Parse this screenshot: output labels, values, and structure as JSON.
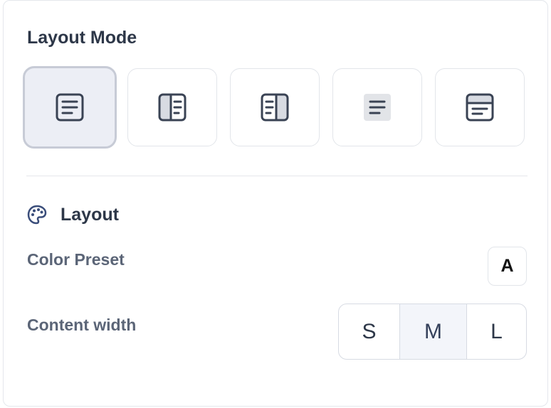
{
  "panel": {
    "title": "Layout Mode",
    "layout_modes": [
      {
        "name": "default",
        "icon": "document-lines-icon",
        "selected": true
      },
      {
        "name": "left-sidebar",
        "icon": "sidebar-left-icon",
        "selected": false
      },
      {
        "name": "right-sidebar",
        "icon": "sidebar-right-icon",
        "selected": false
      },
      {
        "name": "boxed",
        "icon": "boxed-lines-icon",
        "selected": false
      },
      {
        "name": "header-bar",
        "icon": "header-bar-icon",
        "selected": false
      }
    ],
    "layout_section": {
      "title": "Layout",
      "icon": "palette-icon",
      "color_preset_label": "Color Preset",
      "color_preset_value": "A",
      "content_width_label": "Content width",
      "content_width_options": [
        "S",
        "M",
        "L"
      ],
      "content_width_selected": "M"
    }
  },
  "colors": {
    "text_dark": "#2d3748",
    "text_muted": "#5b6577",
    "selected_bg": "#eceef5",
    "border": "#e2e5ea"
  }
}
